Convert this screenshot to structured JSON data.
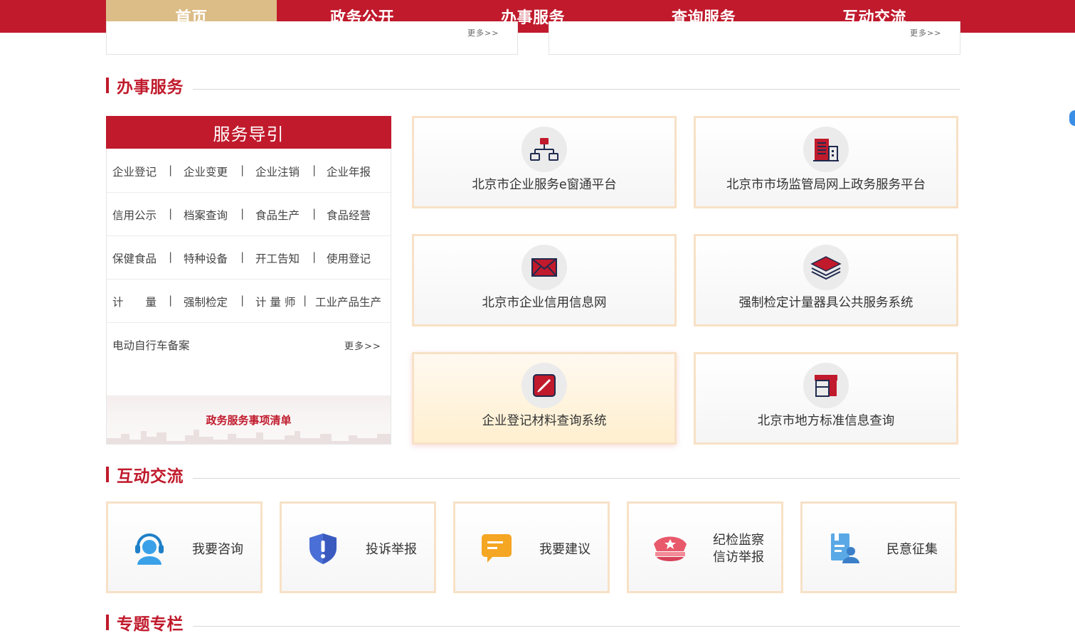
{
  "nav": {
    "items": [
      "首页",
      "政务公开",
      "办事服务",
      "查询服务",
      "互动交流"
    ],
    "active_index": 0
  },
  "prev_section": {
    "more_left": "更多>>",
    "more_right": "更多>>"
  },
  "sections": {
    "service": "办事服务",
    "interaction": "互动交流",
    "special": "专题专栏"
  },
  "guide": {
    "title": "服务导引",
    "rows": [
      [
        "企业登记",
        "企业变更",
        "企业注销",
        "企业年报"
      ],
      [
        "信用公示",
        "档案查询",
        "食品生产",
        "食品经营"
      ],
      [
        "保健食品",
        "特种设备",
        "开工告知",
        "使用登记"
      ],
      [
        "计　　量",
        "强制检定",
        "计 量 师",
        "工业产品生产"
      ]
    ],
    "separator": "|",
    "last_item": "电动自行车备案",
    "more": "更多>>",
    "footer_link": "政务服务事项清单"
  },
  "tiles": [
    {
      "label": "北京市企业服务e窗通平台",
      "icon": "org-chart-icon"
    },
    {
      "label": "北京市市场监管局网上政务服务平台",
      "icon": "building-icon"
    },
    {
      "label": "北京市企业信用信息网",
      "icon": "envelope-icon"
    },
    {
      "label": "强制检定计量器具公共服务系统",
      "icon": "layers-icon"
    },
    {
      "label": "企业登记材料查询系统",
      "icon": "edit-icon"
    },
    {
      "label": "北京市地方标准信息查询",
      "icon": "kiosk-icon"
    }
  ],
  "interaction": [
    {
      "label": "我要咨询",
      "icon": "customer-service-icon"
    },
    {
      "label": "投诉举报",
      "icon": "shield-alert-icon"
    },
    {
      "label": "我要建议",
      "icon": "chat-bubble-icon"
    },
    {
      "label_line1": "纪检监察",
      "label_line2": "信访举报",
      "icon": "police-cap-icon"
    },
    {
      "label": "民意征集",
      "icon": "survey-person-icon"
    }
  ],
  "colors": {
    "brand": "#c01a2c",
    "active_tab": "#dcbd87",
    "tile_border": "#f8e1c6"
  }
}
